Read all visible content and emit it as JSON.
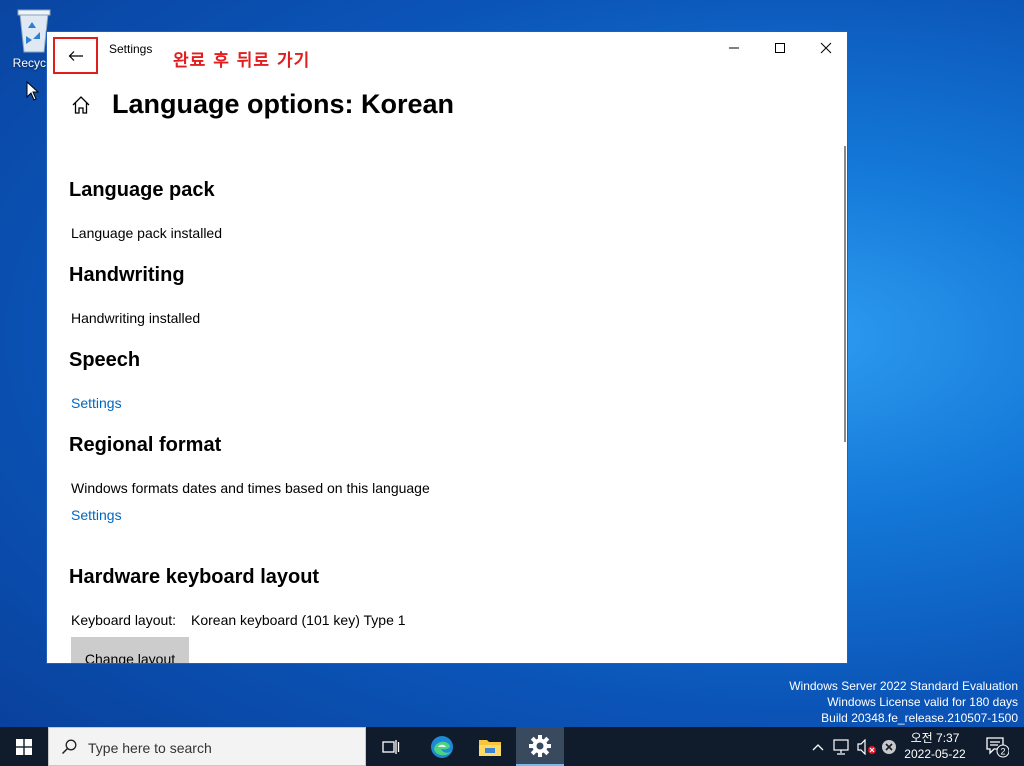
{
  "desktop": {
    "recycle_bin_label": "Recycle",
    "watermark": {
      "line1": "Windows Server 2022 Standard Evaluation",
      "line2": "Windows License valid for 180 days",
      "line3": "Build 20348.fe_release.210507-1500"
    }
  },
  "window": {
    "title": "Settings",
    "annotation": "완료 후 뒤로 가기",
    "annotation_color": "#e01e1e",
    "page_title": "Language options: Korean"
  },
  "sections": {
    "language_pack": {
      "heading": "Language pack",
      "status": "Language pack installed"
    },
    "handwriting": {
      "heading": "Handwriting",
      "status": "Handwriting installed"
    },
    "speech": {
      "heading": "Speech",
      "link": "Settings"
    },
    "regional_format": {
      "heading": "Regional format",
      "description": "Windows formats dates and times based on this language",
      "link": "Settings"
    },
    "keyboard": {
      "heading": "Hardware keyboard layout",
      "label": "Keyboard layout:",
      "value": "Korean keyboard (101 key) Type 1",
      "button": "Change layout"
    }
  },
  "colors": {
    "accent_link": "#0067c0",
    "taskbar": "#101c2c"
  },
  "taskbar": {
    "search_placeholder": "Type here to search",
    "clock_time": "오전 7:37",
    "clock_date": "2022-05-22",
    "notification_count": "2",
    "icons": [
      "start-icon",
      "task-view-icon",
      "edge-icon",
      "file-explorer-icon",
      "settings-icon"
    ]
  }
}
